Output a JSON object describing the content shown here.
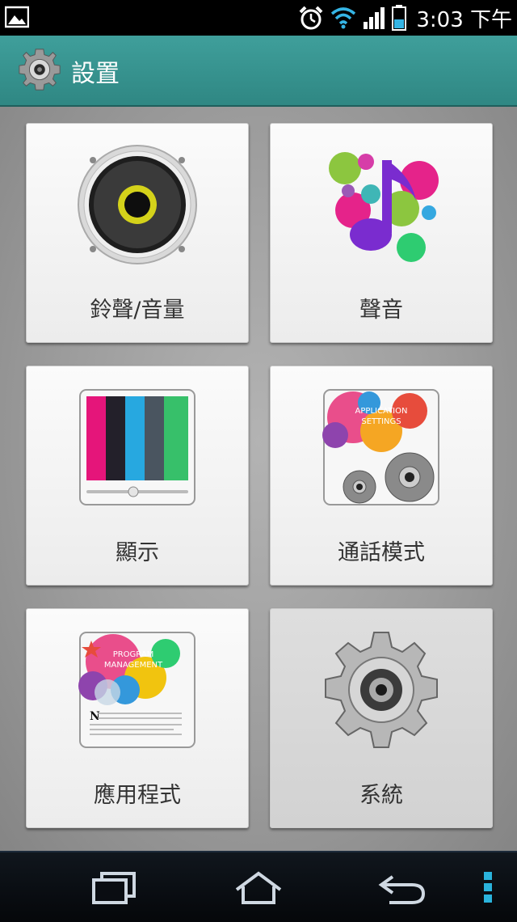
{
  "status_bar": {
    "time": "3:03 下午",
    "icons": [
      "gallery-icon",
      "alarm-icon",
      "wifi-icon",
      "signal-icon",
      "battery-icon"
    ]
  },
  "action_bar": {
    "icon": "gear-icon",
    "title": "設置"
  },
  "tiles": [
    {
      "label": "鈴聲/音量",
      "icon": "speaker-icon"
    },
    {
      "label": "聲音",
      "icon": "music-note-icon"
    },
    {
      "label": "顯示",
      "icon": "display-bars-icon"
    },
    {
      "label": "通話模式",
      "icon": "application-settings-icon",
      "icon_text": [
        "APPLICATION",
        "SETTINGS"
      ]
    },
    {
      "label": "應用程式",
      "icon": "program-management-icon",
      "icon_text": [
        "PROGRAM",
        "MANAGEMENT"
      ]
    },
    {
      "label": "系統",
      "icon": "system-gear-icon",
      "pressed": true
    }
  ],
  "nav_bar": {
    "buttons": [
      "recent-apps-icon",
      "home-icon",
      "back-icon",
      "menu-icon"
    ]
  },
  "colors": {
    "action_bar": "#3a9793",
    "background": "#9c9c9c",
    "tile": "#f4f4f4"
  }
}
